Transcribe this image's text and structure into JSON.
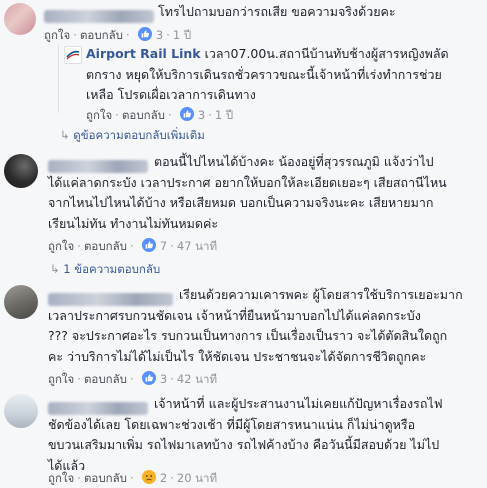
{
  "comments": [
    {
      "id": "c1",
      "text_lines": [
        "โทรไปถามบอกว่ารถเสีย ขอความจริงด้วยคะ"
      ],
      "like": "ถูกใจ",
      "reply": "ตอบกลับ",
      "reaction_count": "3",
      "time": "1 ปี",
      "reply_items": [
        {
          "author": "Airport Rail Link",
          "text_lines": [
            "เวลา07.00น.สถานีบ้านทับช้างผู้สารหญิงพลัด",
            "ตกราง หยุดให้บริการเดินรถชั่วคราวขณะนี้เจ้าหน้าที่เร่งทำการช่วย",
            "เหลือ โปรดเผื่อเวลาการเดินทาง"
          ],
          "like": "ถูกใจ",
          "reply": "ตอบกลับ",
          "reaction_count": "3",
          "time": "1 ปี"
        }
      ],
      "more_replies": "ดูข้อความตอบกลับเพิ่มเติม"
    },
    {
      "id": "c2",
      "text_lines": [
        "ตอนนี้ไปไหนได้บ้างคะ น้องอยู่ที่สุวรรณภูมิ แจ้งว่าไป",
        "ได้แค่ลาดกระบัง เวลาประกาศ อยากให้บอกให้ละเอียดเยอะๆ เสียสถานีไหน",
        "จากไหนไปไหนได้บ้าง หรือเสียหมด บอกเป็นความจริงนะคะ เสียหายมาก",
        "เรียนไม่ทัน ทำงานไม่ทันหมดค่ะ"
      ],
      "like": "ถูกใจ",
      "reply": "ตอบกลับ",
      "reaction_count": "7",
      "time": "47 นาที",
      "replies_link": "1 ข้อความตอบกลับ"
    },
    {
      "id": "c3",
      "text_lines": [
        "เรียนด้วยความเคารพคะ ผู้โดยสารใช้บริการเยอะมาก",
        "เวลาประกาศรบกวนชัดเจน เจ้าหน้าที่ยืนหน้ามาบอกไปได้แค่ลดกระบัง",
        "??? จะประกาศอะไร รบกวนเป็นทางการ เป็นเรื่องเป็นราว จะได้ตัดสินใดถูก",
        "คะ ว่าบริการไม่ได้ไม่เป็นไร ให้ชัดเจน ประชาชนจะได้จัดการชีวิตถูกคะ"
      ],
      "like": "ถูกใจ",
      "reply": "ตอบกลับ",
      "reaction_count": "3",
      "time": "42 นาที"
    },
    {
      "id": "c4",
      "text_lines": [
        "เจ้าหน้าที่ และผู้ประสานงานไม่เคยแก้ปัญหาเรื่องรถไฟ",
        "ชัดข้องได้เลย โดยเฉพาะช่วงเช้า ที่มีผู้โดยสารหนาแน่น ก็ไม่น่าดูหรือ",
        "ขบวนเสริมมาเพิ่ม รถไฟมาเลทบ้าง รถไฟค้างบ้าง คือวันนี้มีสอบด้วย ไม่ไป",
        "ได้แล้ว"
      ],
      "like": "ถูกใจ",
      "reply": "ตอบกลับ",
      "reaction_count": "2",
      "time": "20 นาที"
    }
  ],
  "colors": {
    "background": "#f6f7f9",
    "link_blue": "#385898",
    "meta_gray": "#90949c",
    "text": "#1d2129",
    "like_blue": "#5890ff",
    "sad_yellow": "#f7b125"
  }
}
